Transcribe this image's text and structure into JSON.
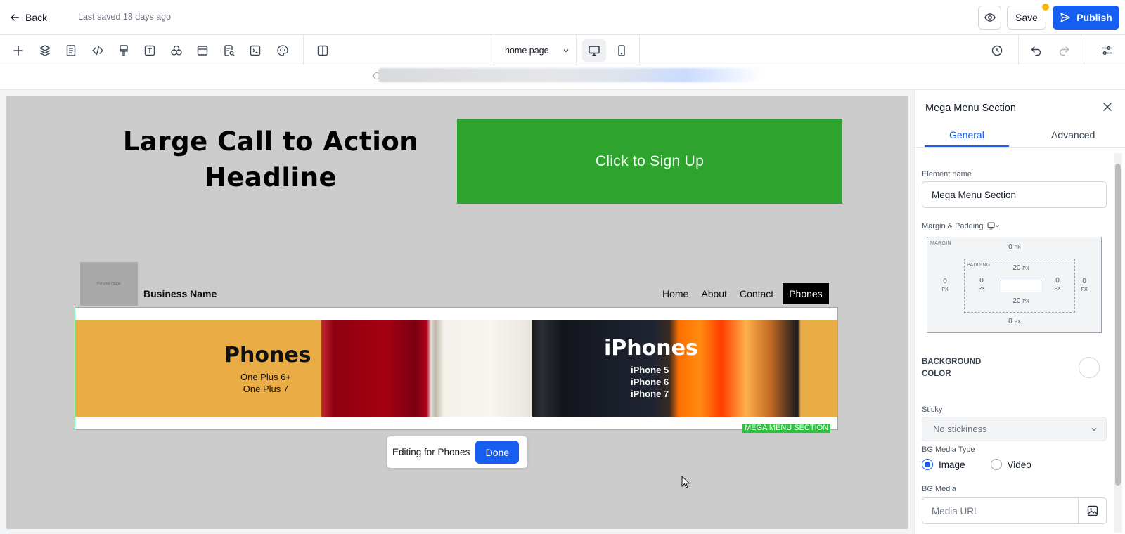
{
  "topbar": {
    "back_label": "Back",
    "last_saved": "Last saved 18 days ago",
    "save_label": "Save",
    "publish_label": "Publish"
  },
  "toolbar": {
    "tools": [
      "add-icon",
      "layers-icon",
      "page-icon",
      "code-icon",
      "paint-icon",
      "text-icon",
      "shapes-icon",
      "section-icon",
      "search-page-icon",
      "terminal-icon",
      "palette-icon",
      "split-view-icon"
    ],
    "page_select": "home page",
    "devices": [
      "desktop-icon",
      "mobile-icon"
    ],
    "right_tools": [
      "history-icon",
      "undo-icon",
      "redo-icon",
      "settings-sliders-icon"
    ]
  },
  "canvas": {
    "cta_headline": "Large Call to Action Headline",
    "cta_button": "Click to Sign Up",
    "logo_placeholder": "Put your image",
    "business_name": "Business Name",
    "nav": [
      "Home",
      "About",
      "Contact",
      "Phones"
    ],
    "nav_active": "Phones",
    "mega": {
      "left_title": "Phones",
      "left_items": [
        "One Plus 6+",
        "One Plus 7"
      ],
      "right_title": "iPhones",
      "right_items": [
        "iPhone 5",
        "iPhone 6",
        "iPhone 7"
      ],
      "tag": "MEGA MENU SECTION"
    },
    "editing_label": "Editing for Phones",
    "done_label": "Done"
  },
  "panel": {
    "title": "Mega Menu Section",
    "tabs": [
      "General",
      "Advanced"
    ],
    "active_tab": "General",
    "element_name_label": "Element name",
    "element_name_value": "Mega Menu Section",
    "margin_padding_label": "Margin & Padding",
    "margin_tag": "MARGIN",
    "padding_tag": "PADDING",
    "margin": {
      "top": "0",
      "right": "0",
      "bottom": "0",
      "left": "0"
    },
    "padding": {
      "top": "20",
      "right": "0",
      "bottom": "20",
      "left": "0"
    },
    "unit": "PX",
    "bg_color_label": "BACKGROUND COLOR",
    "sticky_label": "Sticky",
    "sticky_value": "No stickiness",
    "bg_media_type_label": "BG Media Type",
    "media_types": [
      "Image",
      "Video"
    ],
    "media_type_selected": "Image",
    "bg_media_label": "BG Media",
    "media_url_placeholder": "Media URL"
  },
  "colors": {
    "accent": "#155eef",
    "cta_green": "#2ea42f",
    "mega_orange": "#eaac44",
    "selection_green": "#2ec33e",
    "unsaved_dot": "#f5b800"
  }
}
